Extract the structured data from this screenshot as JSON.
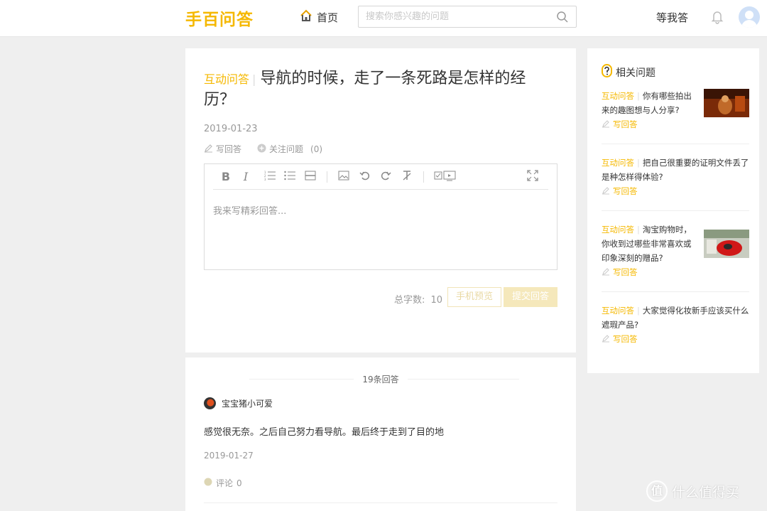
{
  "header": {
    "logo": "手百问答",
    "home_label": "首页",
    "search_placeholder": "搜索你感兴趣的问题",
    "waiting_label": "等我答"
  },
  "question": {
    "tag": "互动问答",
    "title": "导航的时候，走了一条死路是怎样的经历？",
    "date": "2019-01-23",
    "write_label": "写回答",
    "follow_label": "关注问题",
    "follow_count": "(0)",
    "editor_placeholder": "我来写精彩回答...",
    "word_count_label": "总字数:",
    "word_count": "10",
    "preview_label": "手机预览",
    "submit_label": "提交回答"
  },
  "answers": {
    "count_label": "19条回答",
    "items": [
      {
        "user": "宝宝猪小可爱",
        "text": "感觉很无奈。之后自己努力看导航。最后终于走到了目的地",
        "date": "2019-01-27",
        "comment_label": "评论",
        "comment_count": "0"
      }
    ]
  },
  "sidebar": {
    "title": "相关问题",
    "items": [
      {
        "tag": "互动问答",
        "text": "你有哪些拍出来的趣图想与人分享?",
        "write_label": "写回答"
      },
      {
        "tag": "互动问答",
        "text": "把自己很重要的证明文件丢了是种怎样得体验?",
        "write_label": "写回答"
      },
      {
        "tag": "互动问答",
        "text": "淘宝购物时，你收到过哪些非常喜欢或印象深刻的赠品?",
        "write_label": "写回答"
      },
      {
        "tag": "互动问答",
        "text": "大家觉得化妆新手应该买什么遮瑕产品?",
        "write_label": "写回答"
      }
    ]
  },
  "watermark": {
    "glyph": "值",
    "text": "什么值得买"
  },
  "colors": {
    "accent": "#f5b800",
    "background": "#efefef",
    "submit_disabled": "#f5e8bb"
  }
}
